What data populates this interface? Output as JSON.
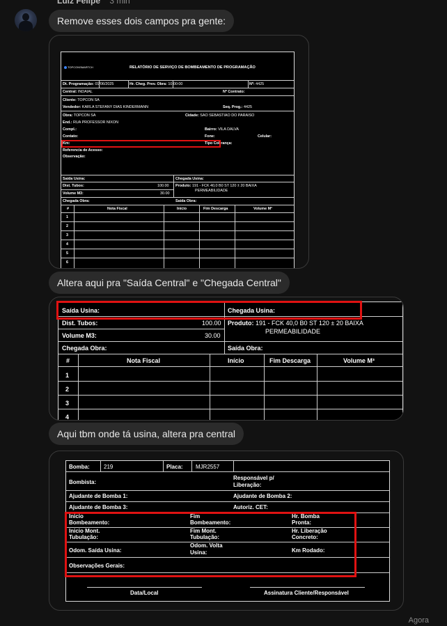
{
  "chat": {
    "sender": "Luiz Felipe",
    "time": "3 min",
    "footer_time": "Agora"
  },
  "messages": [
    {
      "text": "Remove esses dois campos pra gente:"
    },
    {
      "text": "Altera aqui pra \"Saída Central\"  e \"Chegada Central\""
    },
    {
      "text": "Aqui tbm onde tá usina, altera pra central"
    }
  ],
  "doc1": {
    "logo": "TOPCONSMARTCH",
    "title": "RELATÓRIO DE SERVIÇO DE BOMBEAMENTO DE PROGRAMAÇÃO",
    "dt_label": "Dt. Programação:",
    "dt_value": "01/06/2025",
    "hr_label": "Hr. Cheg. Prev. Obra:",
    "hr_value": "10:00:00",
    "n_label": "Nº:",
    "n_value": "4425",
    "central_label": "Central:",
    "central_value": "INDAIAL",
    "contrato_label": "Nº Contrato:",
    "cliente_label": "Cliente:",
    "cliente_value": "TOPCON SA",
    "vendedor_label": "Vendedor:",
    "vendedor_value": "KARLA STEFANY DIAS KINDERMANN",
    "seq_label": "Seq. Prog.:",
    "seq_value": "4425",
    "obra_label": "Obra:",
    "obra_value": "TOPCON SA",
    "cidade_label": "Cidade:",
    "cidade_value": "SAO SEBASTIAO DO PARAISO",
    "end_label": "End.:",
    "end_value": "RUA PROFESSOR NIXON",
    "compl_label": "Compl.:",
    "bairro_label": "Bairro:",
    "bairro_value": "VILA DALVA",
    "contato_label": "Contato:",
    "fone_label": "Fone:",
    "celular_label": "Celular:",
    "km_label": "Km:",
    "tipo_label": "Tipo Cobrança:",
    "ref_label": "Referencia de Acesso:",
    "obs_label": "Observação:",
    "saida_usina": "Saída Usina:",
    "chegada_usina": "Chegada Usina:",
    "dist_label": "Dist. Tubos:",
    "dist_value": "100.00",
    "vol_label": "Volume M3:",
    "vol_value": "30.00",
    "produto_label": "Produto:",
    "produto_value": "191 - FCK 40,0 B0 ST 120 ± 20 BAIXA",
    "produto_value2": "PERMEABILIDADE",
    "chegada_obra": "Chegada Obra:",
    "saida_obra": "Saída Obra:",
    "table_headers": [
      "#",
      "Nota Fiscal",
      "Início",
      "Fim Descarga",
      "Volume M³"
    ],
    "rows": [
      "1",
      "2",
      "3",
      "4",
      "5",
      "6"
    ]
  },
  "doc2": {
    "saida_usina": "Saída Usina:",
    "chegada_usina": "Chegada Usina:",
    "dist_label": "Dist. Tubos:",
    "dist_value": "100.00",
    "vol_label": "Volume M3:",
    "vol_value": "30.00",
    "produto_label": "Produto:",
    "produto_value": "191 - FCK 40,0 B0 ST 120 ± 20 BAIXA",
    "produto_value2": "PERMEABILIDADE",
    "chegada_obra": "Chegada Obra:",
    "saida_obra": "Saída Obra:",
    "table_headers": [
      "#",
      "Nota Fiscal",
      "Início",
      "Fim Descarga",
      "Volume M³"
    ],
    "rows": [
      "1",
      "2",
      "3",
      "4"
    ]
  },
  "doc3": {
    "bomba_label": "Bomba:",
    "bomba_value": "219",
    "placa_label": "Placa:",
    "placa_value": "MJR2557",
    "bombista_label": "Bombista:",
    "resp_label": "Responsável p/",
    "resp_label2": "Liberação:",
    "aj1_label": "Ajudante de Bomba 1:",
    "aj2_label": "Ajudante de Bomba 2:",
    "aj3_label": "Ajudante de Bomba 3:",
    "autoriz_label": "Autoriz. CET:",
    "inicio_bomb": "Inicio",
    "inicio_bomb2": "Bombeamento:",
    "fim_bomb": "Fim",
    "fim_bomb2": "Bombeamento:",
    "hr_bomba": "Hr. Bomba",
    "hr_bomba2": "Pronta:",
    "inicio_mont": "Inicio Mont.",
    "inicio_mont2": "Tubulação:",
    "fim_mont": "Fim Mont.",
    "fim_mont2": "Tubulação:",
    "hr_lib": "Hr. Liberação",
    "hr_lib2": "Concreto:",
    "odom_saida": "Odom. Saída Usina:",
    "odom_volta": "Odom. Volta",
    "odom_volta2": "Usina:",
    "km_rodado": "Km Rodado:",
    "obs_gerais": "Observações Gerais:",
    "data_local": "Data/Local",
    "assinatura": "Assinatura Cliente/Responsável"
  }
}
